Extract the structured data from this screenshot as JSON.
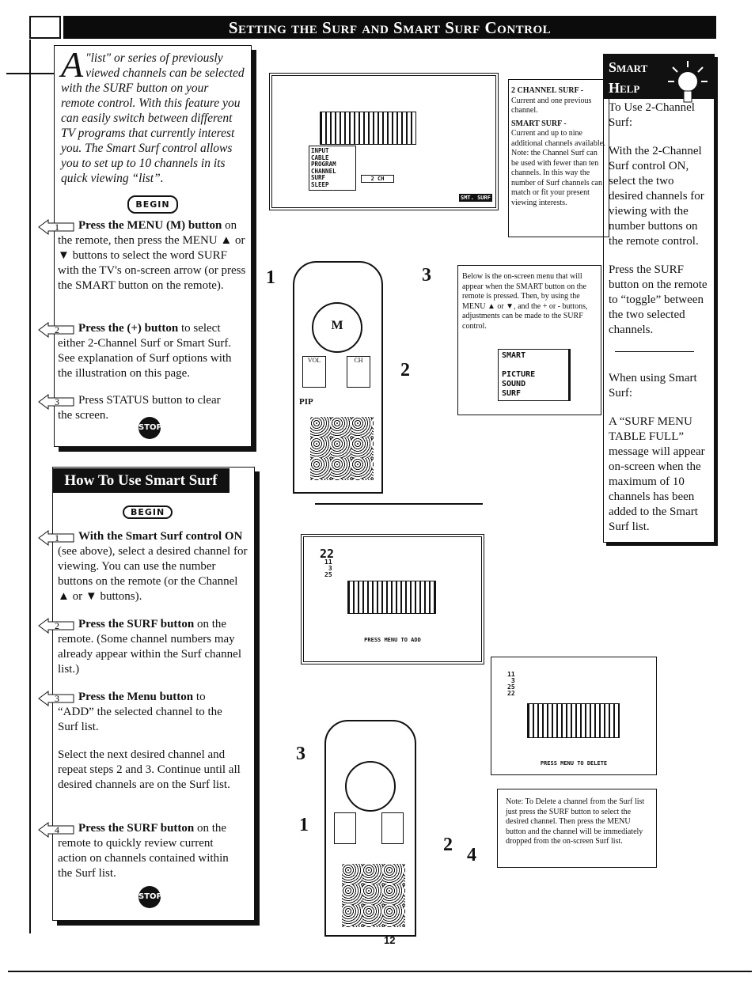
{
  "header": {
    "title": "Setting the Surf and Smart Surf Control"
  },
  "intro": {
    "dropcap": "A",
    "text": "\"list\" or series of previously viewed channels can be selected with the SURF button on your remote control. With this feature you can easily switch between different TV programs that currently interest you. The Smart Surf control allows you to set up to 10 channels in its quick viewing “list”.",
    "begin": "BEGIN"
  },
  "steps": [
    {
      "n": "1",
      "bold": "Press the MENU (M) button",
      "text": " on the remote, then press the MENU ▲ or ▼ buttons to select the word SURF with the TV's on-screen arrow (or press the SMART button on the remote)."
    },
    {
      "n": "2",
      "bold": "Press the (+) button",
      "text": " to select either 2-Channel Surf or Smart Surf. See explanation of Surf options with the illustration on this page."
    },
    {
      "n": "3",
      "bold": "",
      "text": "Press STATUS button to clear the screen."
    }
  ],
  "stop_label": "STOP",
  "how": {
    "title": "How To Use Smart Surf",
    "begin": "BEGIN",
    "steps": [
      {
        "n": "1",
        "bold": "With the Smart Surf control ON",
        "text": " (see above), select a desired channel for viewing. You can use the number buttons on the remote (or the Channel ▲ or ▼ buttons)."
      },
      {
        "n": "2",
        "bold": "Press the SURF button",
        "text": " on the remote. (Some channel numbers may already appear within the Surf channel list.)"
      },
      {
        "n": "3",
        "bold": "Press the Menu button",
        "text": " to “ADD” the selected channel to the Surf list."
      },
      {
        "n": "",
        "bold": "",
        "text": "Select the next desired channel and repeat steps 2 and 3. Continue until all desired channels are on the Surf list."
      },
      {
        "n": "4",
        "bold": "Press the SURF button",
        "text": " on the remote to quickly review current action on channels contained within the Surf list."
      }
    ]
  },
  "tv1": {
    "menu": [
      "INPUT",
      "CABLE",
      "PROGRAM",
      "CHANNEL",
      "SURF",
      "SLEEP"
    ],
    "selected": "SURF",
    "option": "2 CH",
    "button": "SMT. SURF"
  },
  "surf_notes": {
    "t1": "2 CHANNEL SURF -",
    "d1": "Current and one previous channel.",
    "t2": "SMART SURF -",
    "d2": "Current and up to nine additional channels available. Note: the Channel Surf can be used with fewer than ten channels. In this way the number of Surf channels can match or fit your present viewing interests."
  },
  "menu_note": {
    "text": "Below is the on-screen menu that will appear when the SMART button on the remote is pressed. Then, by using the MENU ▲ or ▼, and the + or - buttons, adjustments can be made to the SURF control.",
    "menu": [
      "SMART",
      "PICTURE",
      "SOUND",
      "SURF"
    ]
  },
  "smart_help": {
    "title1": "Smart",
    "title2": "Help",
    "p": [
      "To Use 2-Channel Surf:",
      "With the 2-Channel Surf control ON, select the two desired channels for viewing with the number buttons on the remote control.",
      "Press the SURF button on the remote to “toggle” between the two selected channels.",
      "When using Smart Surf:",
      "A “SURF MENU TABLE FULL” message will appear on-screen when the maximum of 10 channels has been added to the Smart Surf list."
    ]
  },
  "tv2": {
    "big": "22",
    "list": [
      "11",
      "3",
      "25"
    ],
    "caption": "PRESS MENU TO ADD"
  },
  "tv3": {
    "list": [
      "11",
      "3",
      "25",
      "22"
    ],
    "caption": "PRESS MENU TO DELETE"
  },
  "delete_note": "Note: To Delete a channel from the Surf list just press the SURF button to select the desired channel. Then press the MENU button and the channel will be immediately dropped from the on-screen Surf list.",
  "remote1": {
    "labels": [
      "PIP",
      "M",
      "VOL",
      "CH"
    ],
    "callouts": [
      "1",
      "3",
      "2"
    ]
  },
  "remote2": {
    "callouts": [
      "3",
      "1",
      "2",
      "4"
    ]
  },
  "page_number": "12"
}
